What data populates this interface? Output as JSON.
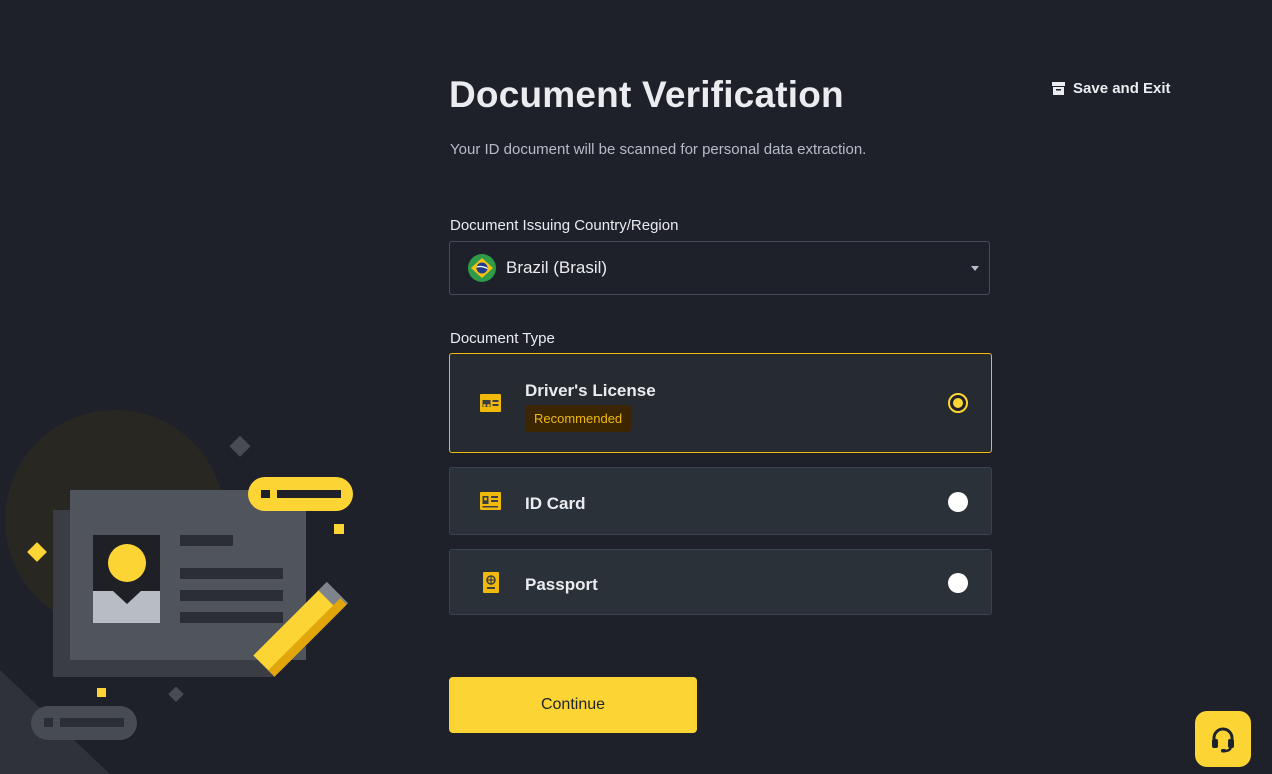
{
  "header": {
    "title": "Document Verification",
    "subtitle": "Your ID document will be scanned for personal data extraction.",
    "save_exit_label": "Save and Exit"
  },
  "country": {
    "label": "Document Issuing Country/Region",
    "selected": "Brazil (Brasil)",
    "flag_icon": "brazil-flag-icon"
  },
  "document_type": {
    "label": "Document Type",
    "options": [
      {
        "label": "Driver's License",
        "badge": "Recommended",
        "icon": "drivers-license-icon",
        "selected": true
      },
      {
        "label": "ID Card",
        "icon": "id-card-icon",
        "selected": false
      },
      {
        "label": "Passport",
        "icon": "passport-icon",
        "selected": false
      }
    ]
  },
  "actions": {
    "continue_label": "Continue"
  },
  "support": {
    "icon": "headset-icon"
  },
  "colors": {
    "accent": "#fcd535",
    "background": "#1e2129",
    "card": "#2b3139",
    "selected_border": "#f0b90b"
  }
}
